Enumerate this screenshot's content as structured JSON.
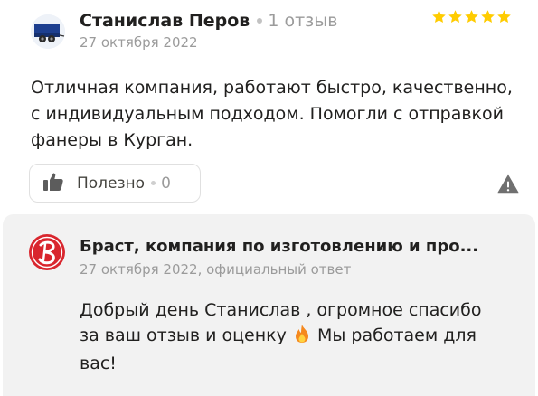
{
  "review": {
    "author_name": "Станислав Перов",
    "author_reviews": "1 отзыв",
    "date": "27 октября 2022",
    "rating": 5,
    "rating_max": 5,
    "star_color": "#ffcc00",
    "text": "Отличная компания, работают быстро, качественно, с индивидуальным подходом. Помогли с отправкой фанеры в Курган."
  },
  "helpful": {
    "label": "Полезно",
    "count": "0",
    "icon": "thumbs-up-icon"
  },
  "report": {
    "icon": "warning-icon"
  },
  "reply": {
    "company_name": "Браст, компания по изготовлению и про...",
    "date": "27 октября 2022, официальный ответ",
    "text_before_emoji": "Добрый день Станислав , огромное спасибо за ваш отзыв и оценку",
    "emoji": "flame-icon",
    "text_after_emoji": "Мы работаем для вас!",
    "logo_color": "#d9262e"
  }
}
